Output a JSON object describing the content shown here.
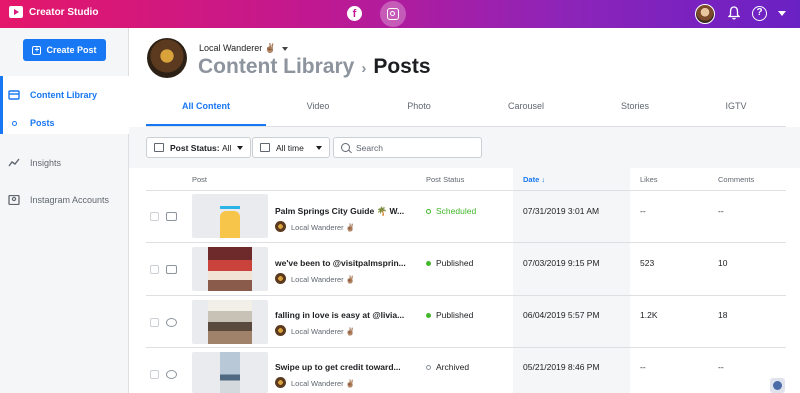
{
  "app": {
    "title": "Creator Studio"
  },
  "sidebar": {
    "create_label": "Create Post",
    "items": [
      {
        "label": "Content Library",
        "icon": "content-library-icon",
        "active": true
      },
      {
        "label": "Posts",
        "icon": "dot-icon",
        "active": true
      },
      {
        "label": "Insights",
        "icon": "insights-icon",
        "active": false
      },
      {
        "label": "Instagram Accounts",
        "icon": "account-icon",
        "active": false
      }
    ]
  },
  "header": {
    "account": "Local Wanderer ✌🏽",
    "breadcrumb": {
      "parent": "Content Library",
      "current": "Posts"
    }
  },
  "tabs": [
    "All Content",
    "Video",
    "Photo",
    "Carousel",
    "Stories",
    "IGTV"
  ],
  "active_tab": "All Content",
  "filters": {
    "status_label": "Post Status:",
    "status_value": "All",
    "time_value": "All time",
    "search_placeholder": "Search"
  },
  "table": {
    "columns": [
      "Post",
      "Post Status",
      "Date ↓",
      "Likes",
      "Comments"
    ],
    "rows": [
      {
        "type_icon": "monitor-icon",
        "caption": "Palm Springs City Guide 🌴 W...",
        "author": "Local Wanderer ✌🏽",
        "status": "Scheduled",
        "date": "07/31/2019 3:01 AM",
        "likes": "--",
        "comments": "--"
      },
      {
        "type_icon": "photo-icon",
        "caption": "we've been to @visitpalmsprin...",
        "author": "Local Wanderer ✌🏽",
        "status": "Published",
        "date": "07/03/2019 9:15 PM",
        "likes": "523",
        "comments": "10"
      },
      {
        "type_icon": "carousel-icon",
        "caption": "falling in love is easy at @livia...",
        "author": "Local Wanderer ✌🏽",
        "status": "Published",
        "date": "06/04/2019 5:57 PM",
        "likes": "1.2K",
        "comments": "18"
      },
      {
        "type_icon": "story-icon",
        "caption": "Swipe up to get credit toward...",
        "author": "Local Wanderer ✌🏽",
        "status": "Archived",
        "date": "05/21/2019 8:46 PM",
        "likes": "--",
        "comments": "--"
      }
    ]
  },
  "colors": {
    "accent": "#1877f2",
    "brand_gradient_start": "#e4176a",
    "brand_gradient_end": "#6a21c4",
    "published": "#42b72a"
  }
}
